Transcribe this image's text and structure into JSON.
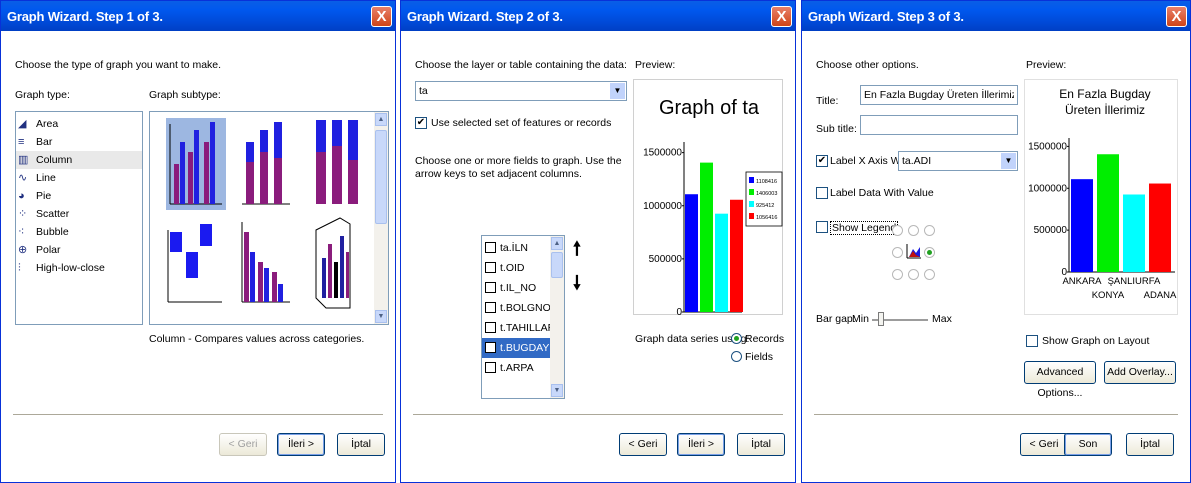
{
  "step1": {
    "title": "Graph Wizard. Step 1 of 3.",
    "close": "X",
    "prompt": "Choose the type of graph you want to make.",
    "graph_type_label": "Graph type:",
    "graph_subtype_label": "Graph subtype:",
    "graph_types": [
      {
        "label": "Area",
        "icon": "area-chart-icon"
      },
      {
        "label": "Bar",
        "icon": "bar-chart-icon"
      },
      {
        "label": "Column",
        "icon": "column-chart-icon"
      },
      {
        "label": "Line",
        "icon": "line-chart-icon"
      },
      {
        "label": "Pie",
        "icon": "pie-chart-icon"
      },
      {
        "label": "Scatter",
        "icon": "scatter-chart-icon"
      },
      {
        "label": "Bubble",
        "icon": "bubble-chart-icon"
      },
      {
        "label": "Polar",
        "icon": "polar-chart-icon"
      },
      {
        "label": "High-low-close",
        "icon": "high-low-close-icon"
      }
    ],
    "selected_type": "Column",
    "description": "Column - Compares values across categories.",
    "buttons": {
      "back": "< Geri",
      "next": "İleri >",
      "cancel": "İptal"
    }
  },
  "step2": {
    "title": "Graph Wizard. Step 2 of 3.",
    "close": "X",
    "layer_prompt": "Choose the layer or table containing the data:",
    "layer_value": "ta",
    "use_selected": "Use selected set of features or records",
    "fields_prompt": "Choose one or more fields to graph. Use the arrow keys to set adjacent columns.",
    "fields": [
      {
        "label": "ta.İLN",
        "checked": false
      },
      {
        "label": "t.OID",
        "checked": false
      },
      {
        "label": "t.IL_NO",
        "checked": false
      },
      {
        "label": "t.BOLGNO",
        "checked": false
      },
      {
        "label": "t.TAHILLAR",
        "checked": false
      },
      {
        "label": "t.BUGDAY",
        "checked": true
      },
      {
        "label": "t.ARPA",
        "checked": false
      }
    ],
    "selected_field": "t.BUGDAY",
    "preview_label": "Preview:",
    "series_label": "Graph data series using:",
    "series_options": [
      "Records",
      "Fields"
    ],
    "series_selected": "Records",
    "buttons": {
      "back": "< Geri",
      "next": "İleri >",
      "cancel": "İptal"
    }
  },
  "step3": {
    "title": "Graph Wizard. Step 3 of 3.",
    "close": "X",
    "prompt": "Choose other options.",
    "title_label": "Title:",
    "title_value": "En Fazla Bugday Üreten İllerimiz",
    "subtitle_label": "Sub title:",
    "subtitle_value": "",
    "label_x_axis": "Label X Axis With:",
    "label_x_axis_value": "ta.ADI",
    "label_data": "Label Data With Value",
    "show_legend": "Show Legend",
    "bar_gap_label": "Bar gap:",
    "bar_gap_min": "Min",
    "bar_gap_max": "Max",
    "preview_label": "Preview:",
    "show_graph_layout": "Show Graph on Layout",
    "advanced_options": "Advanced Options...",
    "add_overlay": "Add Overlay...",
    "buttons": {
      "back": "< Geri",
      "next": "Son",
      "cancel": "İptal"
    }
  },
  "chart_data": [
    {
      "type": "bar",
      "title": "Graph of ta",
      "yticks": [
        "1500000",
        "1000000",
        "500000",
        "0"
      ],
      "ylim": [
        0,
        1600000
      ],
      "series": [
        {
          "name": "1108416",
          "color": "#0000ff",
          "values": [
            1108416
          ]
        },
        {
          "name": "1406003",
          "color": "#00ee00",
          "values": [
            1406003
          ]
        },
        {
          "name": "925412",
          "color": "#00ffff",
          "values": [
            925412
          ]
        },
        {
          "name": "1056416",
          "color": "#ff0000",
          "values": [
            1056416
          ]
        }
      ],
      "legend": "right"
    },
    {
      "type": "bar",
      "title": "En Fazla Bugday Üreten İllerimiz",
      "categories": [
        "ANKARA",
        "KONYA",
        "ŞANLIURFA",
        "ADANA"
      ],
      "values": [
        1108416,
        1406003,
        925412,
        1056416
      ],
      "colors": [
        "#0000ff",
        "#00ee00",
        "#00ffff",
        "#ff0000"
      ],
      "yticks": [
        "1500000",
        "1000000",
        "500000",
        "0"
      ],
      "ylim": [
        0,
        1600000
      ]
    }
  ]
}
